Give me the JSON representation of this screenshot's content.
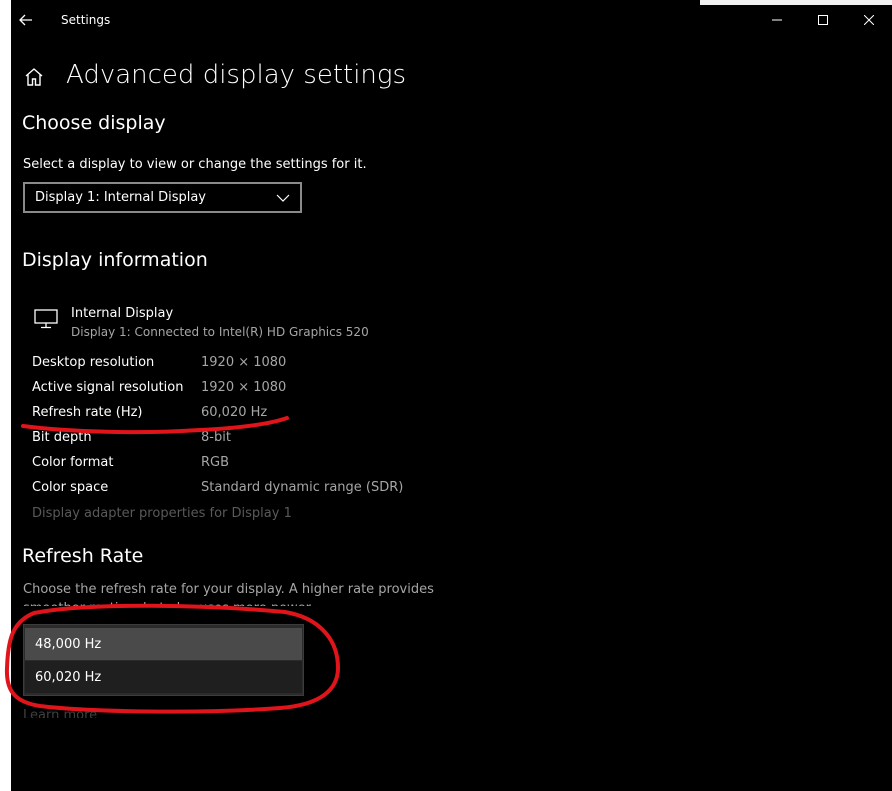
{
  "window": {
    "app_title": "Settings",
    "controls": {
      "minimize_icon": "minimize-icon",
      "maximize_icon": "maximize-icon",
      "close_icon": "close-icon"
    }
  },
  "header": {
    "home_icon": "home-icon",
    "page_title": "Advanced display settings"
  },
  "choose_display": {
    "title": "Choose display",
    "instruction": "Select a display to view or change the settings for it.",
    "selected_display": "Display 1: Internal Display"
  },
  "display_information": {
    "title": "Display information",
    "display_icon": "monitor-icon",
    "display_name": "Internal Display",
    "display_connection": "Display 1: Connected to Intel(R) HD Graphics 520",
    "rows": [
      {
        "label": "Desktop resolution",
        "value": "1920 × 1080"
      },
      {
        "label": "Active signal resolution",
        "value": "1920 × 1080"
      },
      {
        "label": "Refresh rate (Hz)",
        "value": "60,020 Hz"
      },
      {
        "label": "Bit depth",
        "value": "8-bit"
      },
      {
        "label": "Color format",
        "value": "RGB"
      },
      {
        "label": "Color space",
        "value": "Standard dynamic range (SDR)"
      }
    ],
    "adapter_link": "Display adapter properties for Display 1"
  },
  "refresh_rate": {
    "title": "Refresh Rate",
    "description_line1": "Choose the refresh rate for your display. A higher rate provides",
    "description_line2": "smoother motion, but also uses more power.",
    "options": [
      "48,000 Hz",
      "60,020 Hz"
    ],
    "learn_more": "Learn more"
  },
  "colors": {
    "background": "#000000",
    "text": "#ffffff",
    "secondary_text": "#a6a6a6",
    "annotation": "#e0141b"
  }
}
